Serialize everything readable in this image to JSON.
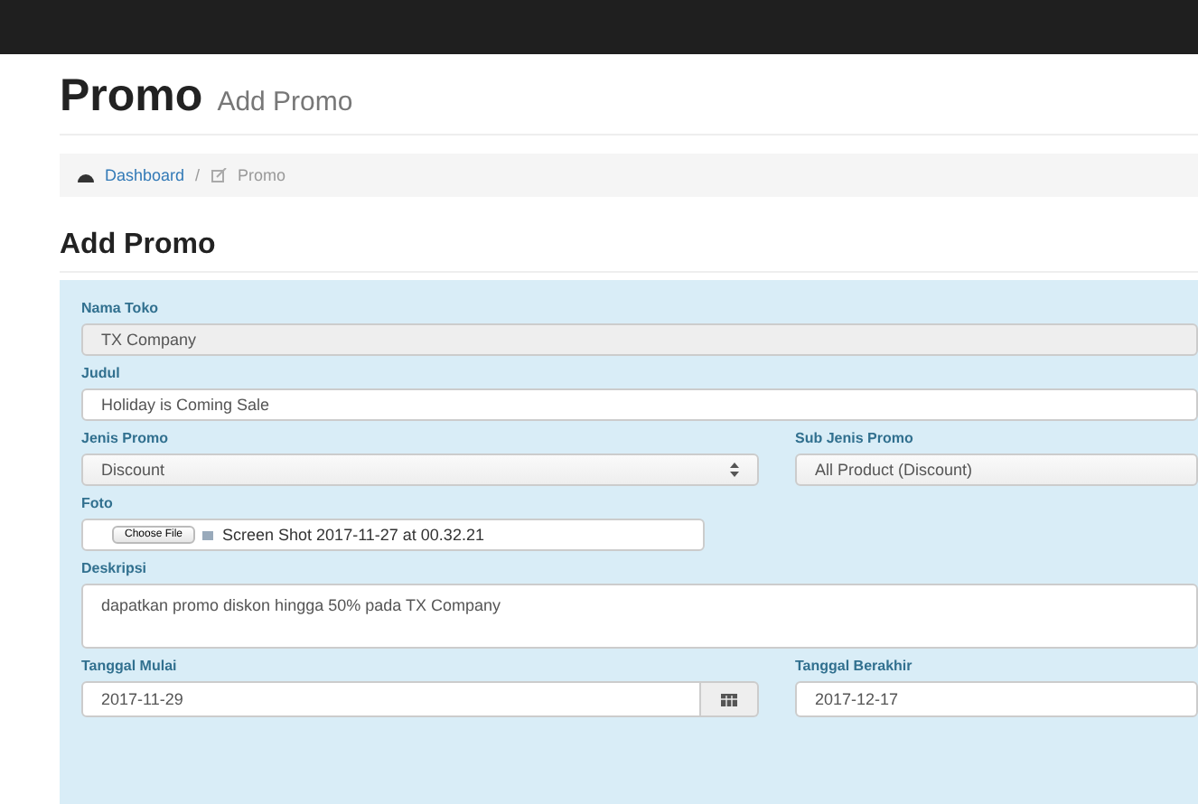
{
  "page_header": {
    "title": "Promo",
    "subtitle": "Add Promo"
  },
  "breadcrumb": {
    "separator": "/",
    "items": [
      {
        "label": "Dashboard",
        "kind": "dashboard",
        "link": true
      },
      {
        "label": "Promo",
        "kind": "edit",
        "link": false
      }
    ]
  },
  "section_title": "Add Promo",
  "form": {
    "nama_toko": {
      "label": "Nama Toko",
      "value": "TX Company",
      "disabled": true
    },
    "judul": {
      "label": "Judul",
      "value": "Holiday is Coming Sale"
    },
    "jenis_promo": {
      "label": "Jenis Promo",
      "value": "Discount"
    },
    "sub_jenis_promo": {
      "label": "Sub Jenis Promo",
      "value": "All Product (Discount)"
    },
    "foto": {
      "label": "Foto",
      "button": "Choose File",
      "file_name": "Screen Shot 2017-11-27 at 00.32.21"
    },
    "deskripsi": {
      "label": "Deskripsi",
      "value": "dapatkan promo diskon hingga 50% pada TX Company"
    },
    "tanggal_mulai": {
      "label": "Tanggal Mulai",
      "value": "2017-11-29"
    },
    "tanggal_berakhir": {
      "label": "Tanggal Berakhir",
      "value": "2017-12-17"
    }
  }
}
